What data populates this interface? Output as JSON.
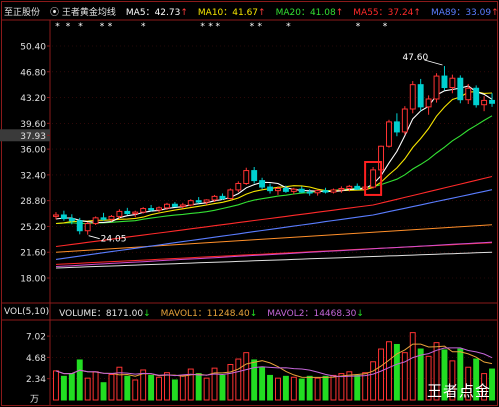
{
  "header": {
    "stock_name": "至正股份",
    "indicator_marker": "⦿",
    "indicator_name": "王者黄金均线",
    "ma5_label": "MA5：42.73",
    "ma10_label": "MA10：41.67",
    "ma20_label": "MA20：41.08",
    "ma55_label": "MA55：37.24",
    "ma89_label": "MA89：33.09",
    "up_arrow": "↑"
  },
  "colors": {
    "ma5": "#ffffff",
    "ma10": "#f5e400",
    "ma20": "#33e033",
    "ma55": "#ff2a2a",
    "ma89": "#5a7dff",
    "up_candle": "#ff3333",
    "down_candle": "#00d0d0",
    "vol_up": "#ff3333",
    "vol_down": "#22dd22",
    "mavol1": "#e7a23a",
    "mavol2": "#c466d8"
  },
  "price_axis": {
    "ticks": [
      "50.40",
      "46.80",
      "43.20",
      "39.60",
      "37.93",
      "36.00",
      "32.40",
      "28.80",
      "25.20",
      "21.60",
      "18.00"
    ],
    "highlight_tick": "37.93"
  },
  "annotations": {
    "high_label": "47.60",
    "low_label": "24.05"
  },
  "star_markers": [
    "*",
    "*",
    "*",
    "*",
    "*",
    "*",
    "*",
    "*",
    "*",
    "*",
    "*",
    "*",
    "*",
    "*"
  ],
  "volume": {
    "title": "VOL(5,10)",
    "volume_label": "VOLUME：8171.00",
    "mavol1_label": "MAVOL1：11248.40",
    "mavol2_label": "MAVOL2：14468.30",
    "down_arrow": "↓",
    "ticks": [
      "7.02",
      "4.68",
      "2.34"
    ],
    "unit": "万"
  },
  "watermark": "王者点金",
  "chart_data": {
    "type": "candlestick",
    "ylim": [
      18.0,
      50.4
    ],
    "candles": [
      [
        26.6,
        27.2,
        26.2,
        26.8
      ],
      [
        26.8,
        27.4,
        26.0,
        26.3
      ],
      [
        26.3,
        26.9,
        25.5,
        26.0
      ],
      [
        26.0,
        26.4,
        24.1,
        24.6
      ],
      [
        24.6,
        25.8,
        24.05,
        25.6
      ],
      [
        25.6,
        26.6,
        25.4,
        26.4
      ],
      [
        26.4,
        27.1,
        26.0,
        26.2
      ],
      [
        26.2,
        26.8,
        25.9,
        26.6
      ],
      [
        26.6,
        27.6,
        26.3,
        27.3
      ],
      [
        27.3,
        27.8,
        26.8,
        27.0
      ],
      [
        27.0,
        27.4,
        26.5,
        27.2
      ],
      [
        27.2,
        27.9,
        27.0,
        27.7
      ],
      [
        27.7,
        28.2,
        27.3,
        27.5
      ],
      [
        27.5,
        28.0,
        27.2,
        27.8
      ],
      [
        27.8,
        28.5,
        27.5,
        28.3
      ],
      [
        28.3,
        28.6,
        27.9,
        28.0
      ],
      [
        28.0,
        28.5,
        27.7,
        28.2
      ],
      [
        28.2,
        29.0,
        28.0,
        28.8
      ],
      [
        28.8,
        29.3,
        28.4,
        28.6
      ],
      [
        28.6,
        29.0,
        28.2,
        28.9
      ],
      [
        28.9,
        29.6,
        28.6,
        29.4
      ],
      [
        29.4,
        29.8,
        28.9,
        29.1
      ],
      [
        29.1,
        30.5,
        29.0,
        30.3
      ],
      [
        30.3,
        31.5,
        30.0,
        31.2
      ],
      [
        31.2,
        33.4,
        31.0,
        33.0
      ],
      [
        33.0,
        33.5,
        31.2,
        31.6
      ],
      [
        31.6,
        32.0,
        30.4,
        30.7
      ],
      [
        30.7,
        31.2,
        29.8,
        30.2
      ],
      [
        30.2,
        30.8,
        29.6,
        30.5
      ],
      [
        30.5,
        30.9,
        29.9,
        30.1
      ],
      [
        30.1,
        30.6,
        29.7,
        30.4
      ],
      [
        30.4,
        30.8,
        29.9,
        30.0
      ],
      [
        30.0,
        30.4,
        29.5,
        29.9
      ],
      [
        29.9,
        30.3,
        29.5,
        30.2
      ],
      [
        30.2,
        30.6,
        29.8,
        30.0
      ],
      [
        30.0,
        30.5,
        29.8,
        30.3
      ],
      [
        30.3,
        30.8,
        29.9,
        30.5
      ],
      [
        30.5,
        31.0,
        30.1,
        30.8
      ],
      [
        30.8,
        31.2,
        30.3,
        30.4
      ],
      [
        30.4,
        30.9,
        30.0,
        30.7
      ],
      [
        30.7,
        33.5,
        30.5,
        33.1
      ],
      [
        33.1,
        36.5,
        33.0,
        36.4
      ],
      [
        36.4,
        40.1,
        36.2,
        39.8
      ],
      [
        39.8,
        41.0,
        37.8,
        38.4
      ],
      [
        38.4,
        42.0,
        38.0,
        41.6
      ],
      [
        41.6,
        45.5,
        41.0,
        45.0
      ],
      [
        45.0,
        45.8,
        41.3,
        41.9
      ],
      [
        41.9,
        43.5,
        40.8,
        43.0
      ],
      [
        43.0,
        46.6,
        42.5,
        46.2
      ],
      [
        46.2,
        47.6,
        44.2,
        44.6
      ],
      [
        44.6,
        46.4,
        43.8,
        45.9
      ],
      [
        45.9,
        46.3,
        42.4,
        42.9
      ],
      [
        42.9,
        45.1,
        42.3,
        44.5
      ],
      [
        44.5,
        44.9,
        41.8,
        42.2
      ],
      [
        42.2,
        43.4,
        41.3,
        42.8
      ],
      [
        42.8,
        43.8,
        41.9,
        42.4
      ]
    ],
    "volume": [
      3.2,
      2.6,
      2.9,
      4.4,
      2.4,
      3.1,
      1.9,
      2.8,
      3.6,
      2.6,
      2.2,
      3.3,
      2.7,
      2.5,
      3.0,
      2.2,
      2.7,
      3.4,
      2.9,
      2.4,
      3.5,
      2.7,
      3.9,
      4.5,
      5.2,
      4.4,
      3.6,
      2.7,
      2.4,
      2.6,
      2.5,
      2.3,
      2.6,
      2.4,
      2.6,
      2.7,
      2.9,
      3.1,
      2.7,
      3.0,
      4.2,
      5.6,
      6.4,
      6.1,
      5.2,
      7.4,
      5.6,
      4.8,
      6.3,
      5.5,
      4.3,
      5.6,
      3.6,
      4.5,
      2.9,
      3.4
    ]
  }
}
